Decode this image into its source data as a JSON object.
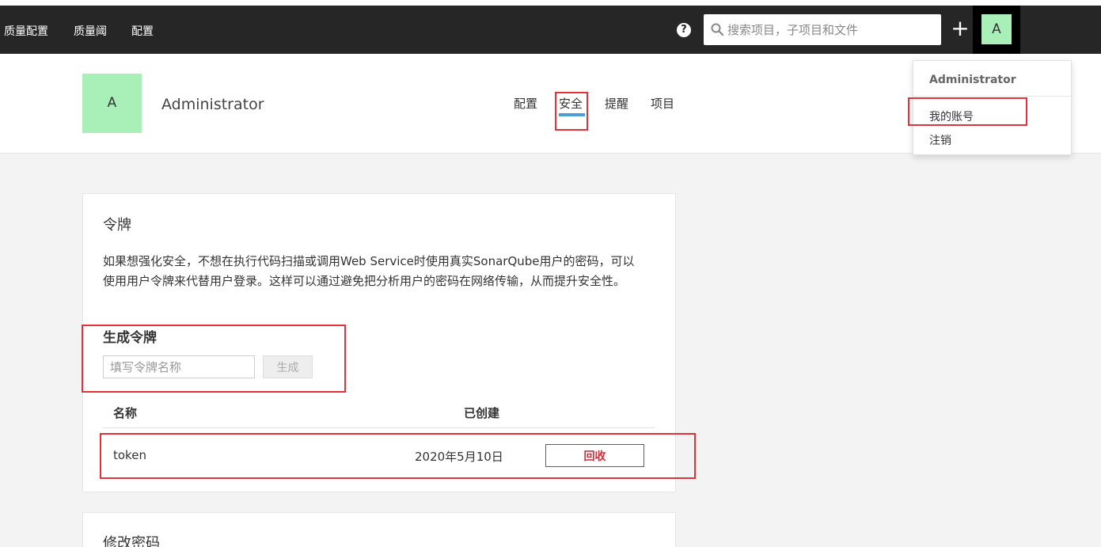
{
  "navbar": {
    "items": [
      "质量配置",
      "质量阈",
      "配置"
    ],
    "help_glyph": "?",
    "search_placeholder": "搜索项目，子项目和文件",
    "plus_glyph": "+",
    "avatar_letter": "A"
  },
  "user": {
    "avatar_letter": "A",
    "name": "Administrator"
  },
  "tabs": [
    {
      "label": "配置",
      "active": false
    },
    {
      "label": "安全",
      "active": true
    },
    {
      "label": "提醒",
      "active": false
    },
    {
      "label": "项目",
      "active": false
    }
  ],
  "dropdown": {
    "header": "Administrator",
    "items": [
      "我的账号",
      "注销"
    ]
  },
  "tokens_card": {
    "title": "令牌",
    "description": "如果想强化安全，不想在执行代码扫描或调用Web Service时使用真实SonarQube用户的密码，可以使用用户令牌来代替用户登录。这样可以通过避免把分析用户的密码在网络传输，从而提升安全性。",
    "generate_title": "生成令牌",
    "input_placeholder": "填写令牌名称",
    "generate_button": "生成",
    "table_headers": [
      "名称",
      "已创建"
    ],
    "rows": [
      {
        "name": "token",
        "created": "2020年5月10日",
        "action": "回收"
      }
    ]
  },
  "password_card": {
    "title": "修改密码"
  },
  "colors": {
    "navbar_bg": "#262626",
    "avatar_green": "#a9f0b8",
    "active_tab": "#4b9fd5",
    "highlight_red": "#e53238",
    "revoke_red": "#d02f3a"
  }
}
